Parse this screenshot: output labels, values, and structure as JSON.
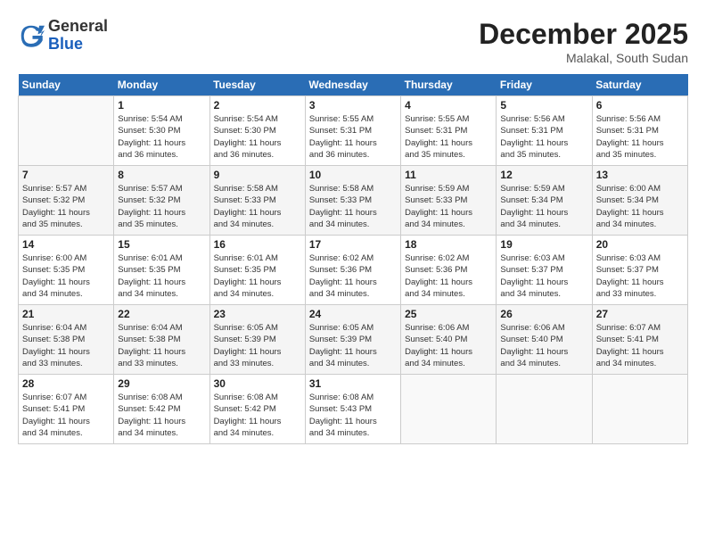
{
  "logo": {
    "general": "General",
    "blue": "Blue"
  },
  "header": {
    "month": "December 2025",
    "location": "Malakal, South Sudan"
  },
  "weekdays": [
    "Sunday",
    "Monday",
    "Tuesday",
    "Wednesday",
    "Thursday",
    "Friday",
    "Saturday"
  ],
  "weeks": [
    [
      {
        "day": "",
        "info": ""
      },
      {
        "day": "1",
        "info": "Sunrise: 5:54 AM\nSunset: 5:30 PM\nDaylight: 11 hours\nand 36 minutes."
      },
      {
        "day": "2",
        "info": "Sunrise: 5:54 AM\nSunset: 5:30 PM\nDaylight: 11 hours\nand 36 minutes."
      },
      {
        "day": "3",
        "info": "Sunrise: 5:55 AM\nSunset: 5:31 PM\nDaylight: 11 hours\nand 36 minutes."
      },
      {
        "day": "4",
        "info": "Sunrise: 5:55 AM\nSunset: 5:31 PM\nDaylight: 11 hours\nand 35 minutes."
      },
      {
        "day": "5",
        "info": "Sunrise: 5:56 AM\nSunset: 5:31 PM\nDaylight: 11 hours\nand 35 minutes."
      },
      {
        "day": "6",
        "info": "Sunrise: 5:56 AM\nSunset: 5:31 PM\nDaylight: 11 hours\nand 35 minutes."
      }
    ],
    [
      {
        "day": "7",
        "info": "Sunrise: 5:57 AM\nSunset: 5:32 PM\nDaylight: 11 hours\nand 35 minutes."
      },
      {
        "day": "8",
        "info": "Sunrise: 5:57 AM\nSunset: 5:32 PM\nDaylight: 11 hours\nand 35 minutes."
      },
      {
        "day": "9",
        "info": "Sunrise: 5:58 AM\nSunset: 5:33 PM\nDaylight: 11 hours\nand 34 minutes."
      },
      {
        "day": "10",
        "info": "Sunrise: 5:58 AM\nSunset: 5:33 PM\nDaylight: 11 hours\nand 34 minutes."
      },
      {
        "day": "11",
        "info": "Sunrise: 5:59 AM\nSunset: 5:33 PM\nDaylight: 11 hours\nand 34 minutes."
      },
      {
        "day": "12",
        "info": "Sunrise: 5:59 AM\nSunset: 5:34 PM\nDaylight: 11 hours\nand 34 minutes."
      },
      {
        "day": "13",
        "info": "Sunrise: 6:00 AM\nSunset: 5:34 PM\nDaylight: 11 hours\nand 34 minutes."
      }
    ],
    [
      {
        "day": "14",
        "info": "Sunrise: 6:00 AM\nSunset: 5:35 PM\nDaylight: 11 hours\nand 34 minutes."
      },
      {
        "day": "15",
        "info": "Sunrise: 6:01 AM\nSunset: 5:35 PM\nDaylight: 11 hours\nand 34 minutes."
      },
      {
        "day": "16",
        "info": "Sunrise: 6:01 AM\nSunset: 5:35 PM\nDaylight: 11 hours\nand 34 minutes."
      },
      {
        "day": "17",
        "info": "Sunrise: 6:02 AM\nSunset: 5:36 PM\nDaylight: 11 hours\nand 34 minutes."
      },
      {
        "day": "18",
        "info": "Sunrise: 6:02 AM\nSunset: 5:36 PM\nDaylight: 11 hours\nand 34 minutes."
      },
      {
        "day": "19",
        "info": "Sunrise: 6:03 AM\nSunset: 5:37 PM\nDaylight: 11 hours\nand 34 minutes."
      },
      {
        "day": "20",
        "info": "Sunrise: 6:03 AM\nSunset: 5:37 PM\nDaylight: 11 hours\nand 33 minutes."
      }
    ],
    [
      {
        "day": "21",
        "info": "Sunrise: 6:04 AM\nSunset: 5:38 PM\nDaylight: 11 hours\nand 33 minutes."
      },
      {
        "day": "22",
        "info": "Sunrise: 6:04 AM\nSunset: 5:38 PM\nDaylight: 11 hours\nand 33 minutes."
      },
      {
        "day": "23",
        "info": "Sunrise: 6:05 AM\nSunset: 5:39 PM\nDaylight: 11 hours\nand 33 minutes."
      },
      {
        "day": "24",
        "info": "Sunrise: 6:05 AM\nSunset: 5:39 PM\nDaylight: 11 hours\nand 34 minutes."
      },
      {
        "day": "25",
        "info": "Sunrise: 6:06 AM\nSunset: 5:40 PM\nDaylight: 11 hours\nand 34 minutes."
      },
      {
        "day": "26",
        "info": "Sunrise: 6:06 AM\nSunset: 5:40 PM\nDaylight: 11 hours\nand 34 minutes."
      },
      {
        "day": "27",
        "info": "Sunrise: 6:07 AM\nSunset: 5:41 PM\nDaylight: 11 hours\nand 34 minutes."
      }
    ],
    [
      {
        "day": "28",
        "info": "Sunrise: 6:07 AM\nSunset: 5:41 PM\nDaylight: 11 hours\nand 34 minutes."
      },
      {
        "day": "29",
        "info": "Sunrise: 6:08 AM\nSunset: 5:42 PM\nDaylight: 11 hours\nand 34 minutes."
      },
      {
        "day": "30",
        "info": "Sunrise: 6:08 AM\nSunset: 5:42 PM\nDaylight: 11 hours\nand 34 minutes."
      },
      {
        "day": "31",
        "info": "Sunrise: 6:08 AM\nSunset: 5:43 PM\nDaylight: 11 hours\nand 34 minutes."
      },
      {
        "day": "",
        "info": ""
      },
      {
        "day": "",
        "info": ""
      },
      {
        "day": "",
        "info": ""
      }
    ]
  ]
}
